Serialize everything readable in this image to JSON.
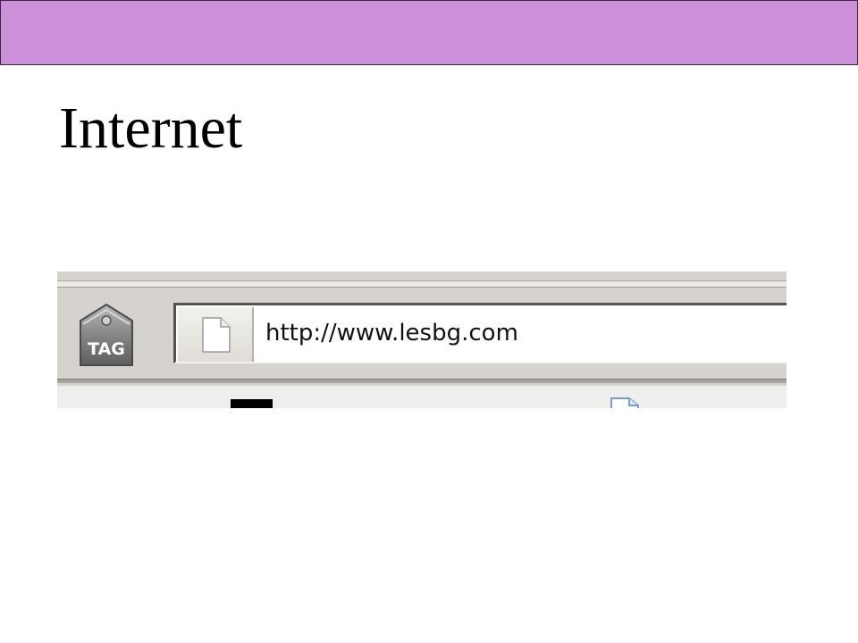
{
  "slide": {
    "title": "Internet",
    "banner_color": "#cc90d8"
  },
  "browser_toolbar": {
    "tag_button": {
      "icon": "tag-icon",
      "label": "TAG"
    },
    "address_bar": {
      "page_icon": "page-icon",
      "url": "http://www.lesbg.com"
    },
    "lower_toolbar_icons": [
      "black-square-icon",
      "page-icon"
    ]
  }
}
